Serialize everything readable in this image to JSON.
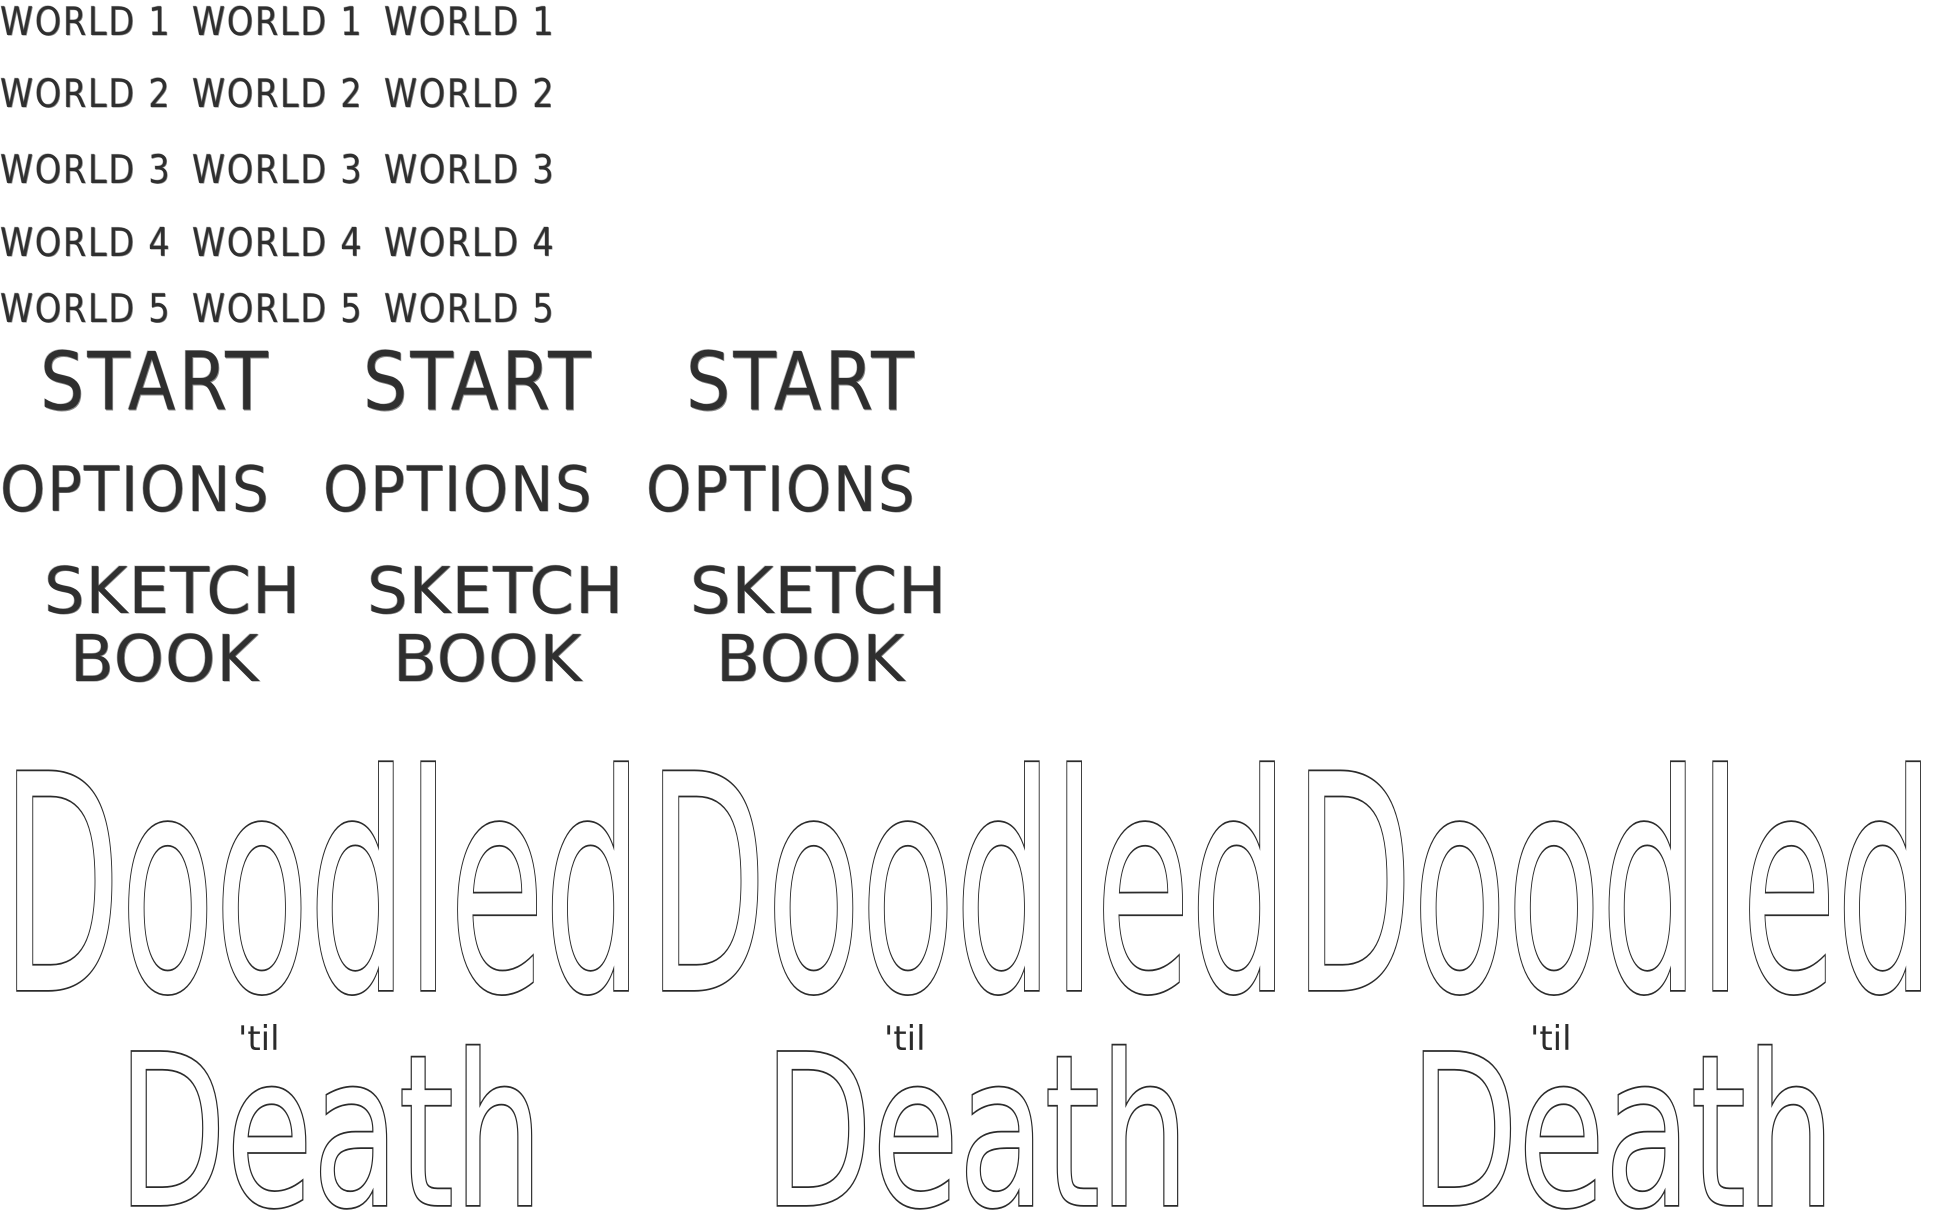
{
  "sprite_sheet": {
    "world_rows": [
      {
        "labels": [
          "WORLD 1",
          "WORLD 1",
          "WORLD 1"
        ]
      },
      {
        "labels": [
          "WORLD 2",
          "WORLD 2",
          "WORLD 2"
        ]
      },
      {
        "labels": [
          "WORLD 3",
          "WORLD 3",
          "WORLD 3"
        ]
      },
      {
        "labels": [
          "WORLD 4",
          "WORLD 4",
          "WORLD 4"
        ]
      },
      {
        "labels": [
          "WORLD 5",
          "WORLD 5",
          "WORLD 5"
        ]
      }
    ],
    "start_labels": [
      "START",
      "START",
      "START"
    ],
    "options_labels": [
      "OPTIONS",
      "OPTIONS",
      "OPTIONS"
    ],
    "sketchbook_labels": [
      {
        "line1": "SKETCH",
        "line2": "BOOK"
      },
      {
        "line1": "SKETCH",
        "line2": "BOOK"
      },
      {
        "line1": "SKETCH",
        "line2": "BOOK"
      }
    ],
    "logos": [
      {
        "title": "Doodled",
        "connector": "'til",
        "subtitle": "Death"
      },
      {
        "title": "Doodled",
        "connector": "'til",
        "subtitle": "Death"
      },
      {
        "title": "Doodled",
        "connector": "'til",
        "subtitle": "Death"
      }
    ]
  },
  "colors": {
    "background": "#ffffff",
    "ink": "#2b2b2b"
  }
}
